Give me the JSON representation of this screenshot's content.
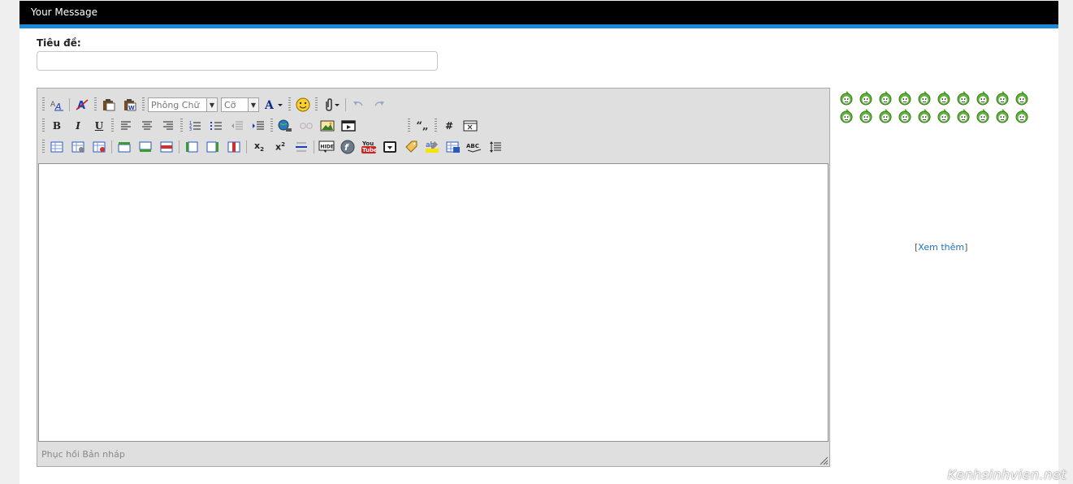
{
  "header": {
    "title": "Your Message"
  },
  "form": {
    "title_label": "Tiêu đề:",
    "title_value": ""
  },
  "toolbar": {
    "font_select": "Phông Chữ",
    "size_select": "Cỡ",
    "row1": [
      "remove-format-icon",
      "remove-style-icon",
      "paste-text-icon",
      "paste-word-icon",
      "font-color-icon",
      "smilies-icon",
      "attach-icon",
      "undo-icon",
      "redo-icon"
    ],
    "row2": [
      "bold-icon",
      "italic-icon",
      "underline-icon",
      "align-left-icon",
      "align-center-icon",
      "align-right-icon",
      "ordered-list-icon",
      "unordered-list-icon",
      "outdent-icon",
      "indent-icon",
      "link-icon",
      "unlink-icon",
      "image-icon",
      "video-icon",
      "quote-icon",
      "hash-icon",
      "code-icon"
    ],
    "row3": [
      "table-icon",
      "table-props-icon",
      "delete-table-icon",
      "insert-row-before-icon",
      "insert-row-after-icon",
      "delete-row-icon",
      "insert-col-before-icon",
      "insert-col-after-icon",
      "delete-col-icon",
      "subscript-icon",
      "superscript-icon",
      "horizontal-rule-icon",
      "hide-icon",
      "flash-icon",
      "youtube-icon",
      "download-icon",
      "tag-icon",
      "highlight-icon",
      "table-insert-icon",
      "spellcheck-icon",
      "line-height-icon"
    ]
  },
  "editor": {
    "status": "Phục hồi Bản nháp"
  },
  "smilies": {
    "count": 20,
    "more_label": "Xem thêm"
  },
  "watermark": "Kenhsinhvien.net",
  "colors": {
    "header_bg": "#000000",
    "header_border": "#1c8ad8",
    "smiley_green": "#5fb33a",
    "link": "#1b6fc2"
  }
}
